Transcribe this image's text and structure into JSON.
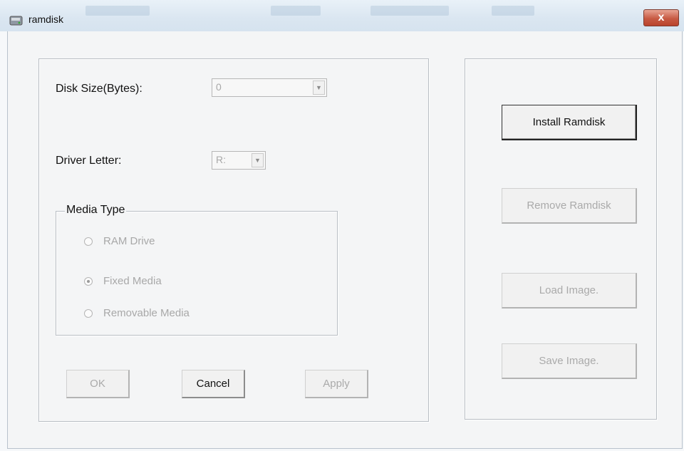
{
  "window": {
    "title": "ramdisk",
    "icon": "disk-drive-icon",
    "close_label": "x"
  },
  "form": {
    "disk_size_label": "Disk Size(Bytes):",
    "disk_size_value": "0",
    "driver_letter_label": "Driver Letter:",
    "driver_letter_value": "R:",
    "media_type": {
      "legend": "Media Type",
      "options": [
        {
          "label": "RAM Drive",
          "checked": false
        },
        {
          "label": "Fixed Media",
          "checked": true
        },
        {
          "label": "Removable Media",
          "checked": false
        }
      ]
    },
    "buttons": {
      "ok": "OK",
      "cancel": "Cancel",
      "apply": "Apply"
    }
  },
  "actions": {
    "install": "Install Ramdisk",
    "remove": "Remove Ramdisk",
    "load": "Load Image.",
    "save": "Save Image."
  },
  "colors": {
    "close_button": "#c75a43",
    "disabled_text": "#aaaaaa"
  }
}
